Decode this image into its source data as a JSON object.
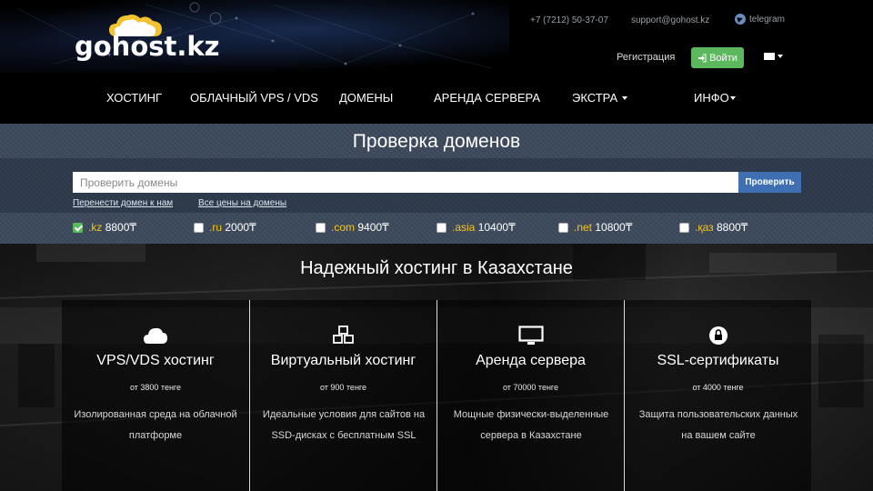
{
  "brand": {
    "logo_text": "gohost.kz"
  },
  "contacts": {
    "phone": "+7 (7212) 50-37-07",
    "email": "support@gohost.kz",
    "telegram": "telegram"
  },
  "auth": {
    "register_label": "Регистрация",
    "login_label": "Войти"
  },
  "language": {
    "icon": "flag-icon"
  },
  "nav": {
    "items": [
      {
        "label": "ХОСТИНГ",
        "dropdown": false
      },
      {
        "label": "ОБЛАЧНЫЙ VPS / VDS",
        "dropdown": false
      },
      {
        "label": "ДОМЕНЫ",
        "dropdown": false
      },
      {
        "label": "АРЕНДА СЕРВЕРА",
        "dropdown": false
      },
      {
        "label": "ЭКСТРА",
        "dropdown": true
      },
      {
        "label": "ИНФО",
        "dropdown": true
      }
    ]
  },
  "domain_check": {
    "title": "Проверка доменов",
    "placeholder": "Проверить домены",
    "button_label": "Проверить",
    "transfer_link": "Перенести домен к нам",
    "prices_link": "Все цены на домены",
    "tlds": [
      {
        "name": ".kz",
        "price": "8800₸",
        "checked": true
      },
      {
        "name": ".ru",
        "price": "2000₸",
        "checked": false
      },
      {
        "name": ".com",
        "price": "9400₸",
        "checked": false
      },
      {
        "name": ".asia",
        "price": "10400₸",
        "checked": false
      },
      {
        "name": ".net",
        "price": "10800₸",
        "checked": false
      },
      {
        "name": ".қаз",
        "price": "8800₸",
        "checked": false
      }
    ]
  },
  "hero": {
    "title": "Надежный хостинг в Казахстане",
    "services": [
      {
        "icon": "cloud-icon",
        "title": "VPS/VDS хостинг",
        "price": "от 3800 тенге",
        "desc": "Изолированная среда на облачной платформе"
      },
      {
        "icon": "cubes-icon",
        "title": "Виртуальный хостинг",
        "price": "от 900 тенге",
        "desc": "Идеальные условия для сайтов на SSD-дисках с бесплатным SSL"
      },
      {
        "icon": "monitor-icon",
        "title": "Аренда сервера",
        "price": "от 70000 тенге",
        "desc": "Мощные физически-выделенные сервера в Казахстане"
      },
      {
        "icon": "lock-icon",
        "title": "SSL-сертификаты",
        "price": "от 4000 тенге",
        "desc": "Защита пользовательских данных на вашем сайте"
      }
    ]
  },
  "colors": {
    "accent_green": "#5cb85c",
    "button_blue": "#3f6fb0",
    "tld_yellow": "#f5c518",
    "section_bg": "#3d4a5c"
  }
}
